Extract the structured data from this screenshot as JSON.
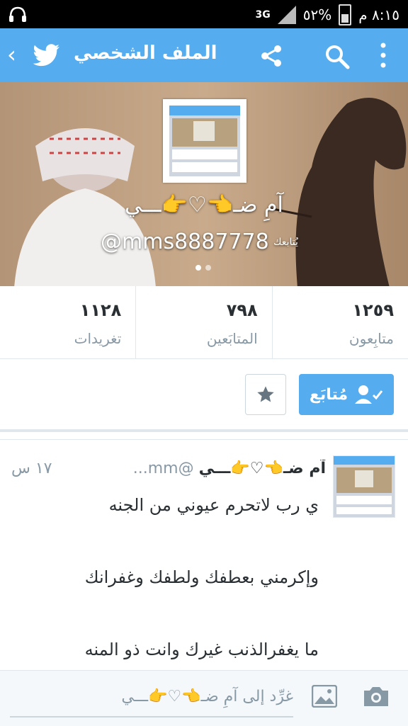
{
  "status_bar": {
    "time": "٨:١٥ م",
    "network": "3G",
    "battery": "٥٢%"
  },
  "app_bar": {
    "title": "الملف الشخصي"
  },
  "profile": {
    "display_name": "آمِ ضـ👈♡👉ـــي",
    "handle": "@mms8887778",
    "follows_you": "يُتابعك"
  },
  "stats": [
    {
      "value": "١٢٥٩",
      "label": "متابِعون"
    },
    {
      "value": "٧٩٨",
      "label": "المتابَعين"
    },
    {
      "value": "١١٢٨",
      "label": "تغريدات"
    }
  ],
  "actions": {
    "follow_label": "مُتابَع"
  },
  "tweet": {
    "name": "آمِ ضـ👈♡👉ـــي",
    "handle": "@mm...",
    "time": "١٧ س",
    "lines": [
      "ي رب لاتحرم عيوني من الجنه",
      "وإكرمني بعطفك ولطفك وغفرانك",
      "ما يغفرالذنب غيرك وانت ذو المنه"
    ]
  },
  "composer": {
    "placeholder": "غرِّد إلى آمِ ضـ👈♡👉ـــي"
  },
  "colors": {
    "accent": "#55acee",
    "text": "#292f33",
    "muted": "#8899a6"
  }
}
